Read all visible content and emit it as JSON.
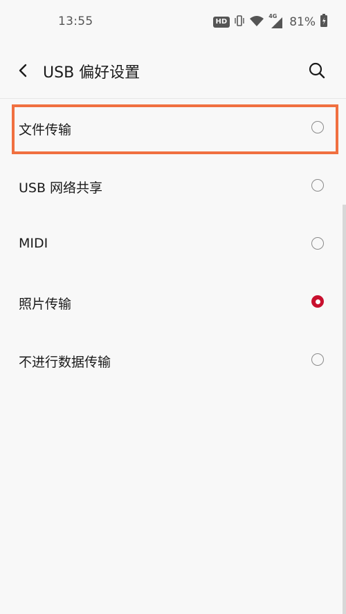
{
  "status_bar": {
    "time": "13:55",
    "hd_badge": "HD",
    "network": "4G",
    "battery": "81%"
  },
  "toolbar": {
    "title": "USB 偏好设置",
    "back_icon": "chevron-left-icon",
    "search_icon": "search-icon"
  },
  "options": [
    {
      "label": "文件传输",
      "selected": false
    },
    {
      "label": "USB 网络共享",
      "selected": false
    },
    {
      "label": "MIDI",
      "selected": false
    },
    {
      "label": "照片传输",
      "selected": true
    },
    {
      "label": "不进行数据传输",
      "selected": false
    }
  ],
  "colors": {
    "accent": "#c8102e",
    "highlight": "#f07040",
    "background": "#f8f8f8"
  }
}
